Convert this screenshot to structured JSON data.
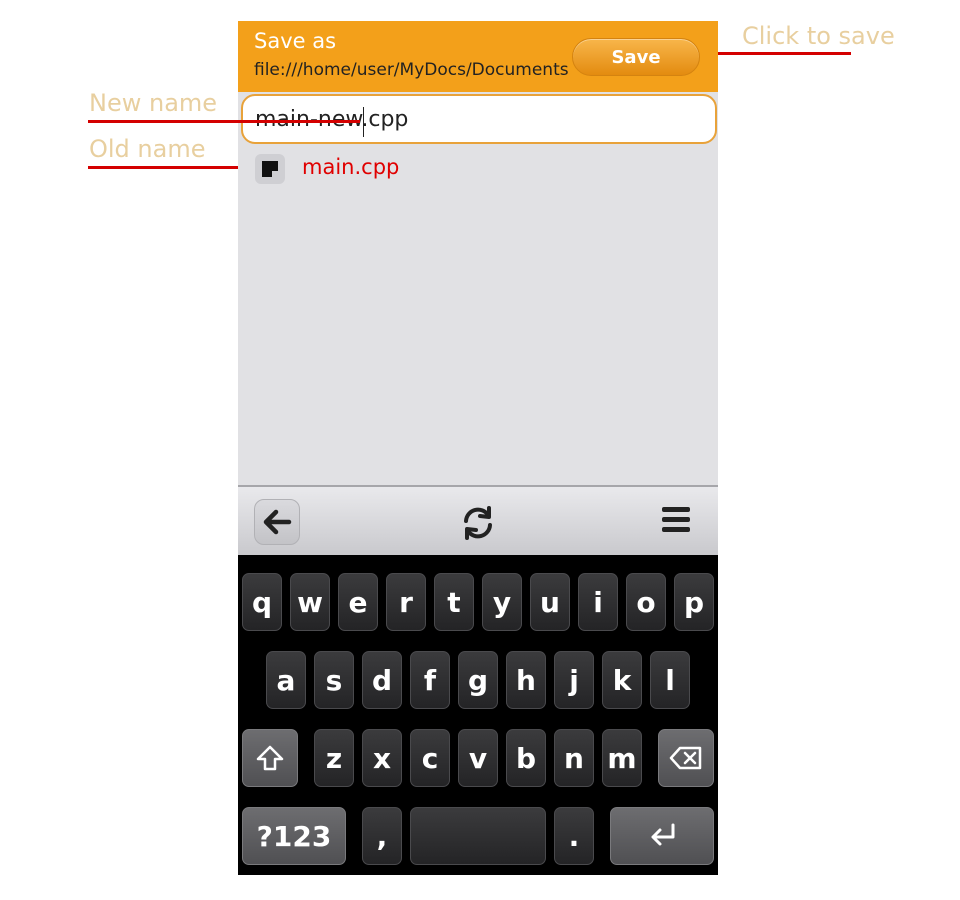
{
  "annotations": {
    "click_to_save": "Click to save",
    "new_name": "New name",
    "old_name": "Old name"
  },
  "header": {
    "title": "Save as",
    "path": "file:///home/user/MyDocs/Documents",
    "save_label": "Save"
  },
  "input": {
    "value": "main-new.cpp"
  },
  "file_list": [
    {
      "name": "main.cpp",
      "icon": "document-icon"
    }
  ],
  "toolbar": {
    "icons": [
      "back-arrow-icon",
      "rotate-icon",
      "menu-icon"
    ]
  },
  "keyboard": {
    "row1": [
      "q",
      "w",
      "e",
      "r",
      "t",
      "y",
      "u",
      "i",
      "o",
      "p"
    ],
    "row2": [
      "a",
      "s",
      "d",
      "f",
      "g",
      "h",
      "j",
      "k",
      "l"
    ],
    "row3": [
      "z",
      "x",
      "c",
      "v",
      "b",
      "n",
      "m"
    ],
    "row4": {
      "symbols": "?123",
      "comma": ",",
      "period": "."
    },
    "icons": [
      "shift-icon",
      "backspace-icon",
      "enter-icon"
    ]
  },
  "colors": {
    "header": "#f3a01a",
    "annotation_text": "#e8cf9f",
    "annotation_line": "#d40000",
    "file_name": "#e00000"
  }
}
